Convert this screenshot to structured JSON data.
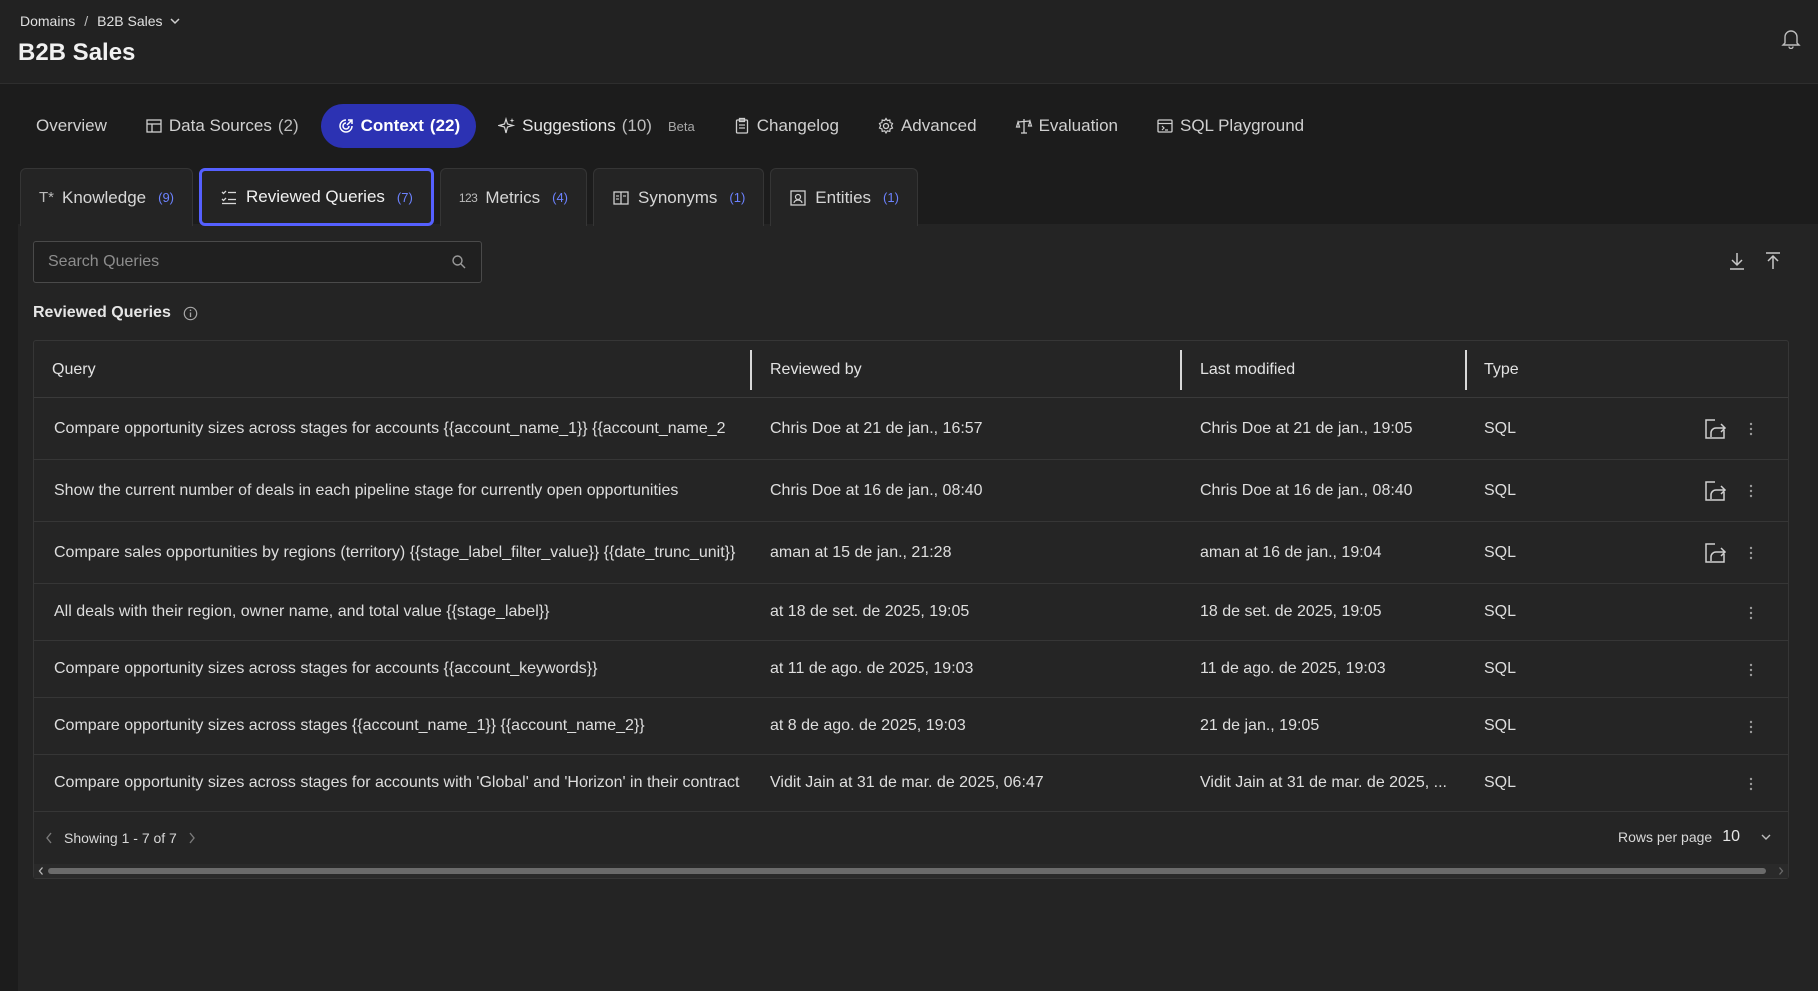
{
  "header": {
    "breadcrumb": [
      "Domains",
      "/",
      "B2B Sales"
    ],
    "title": "B2B Sales"
  },
  "main_tabs": [
    {
      "label": "Overview",
      "count": "",
      "icon": "none"
    },
    {
      "label": "Data Sources",
      "count": "(2)",
      "icon": "table-icon"
    },
    {
      "label": "Context",
      "count": "(22)",
      "icon": "context-icon"
    },
    {
      "label": "Suggestions",
      "count": "(10)",
      "icon": "sparkle-icon",
      "badge": "Beta"
    },
    {
      "label": "Changelog",
      "count": "",
      "icon": "clipboard-icon"
    },
    {
      "label": "Advanced",
      "count": "",
      "icon": "gear-icon"
    },
    {
      "label": "Evaluation",
      "count": "",
      "icon": "scale-icon"
    },
    {
      "label": "SQL Playground",
      "count": "",
      "icon": "playground-icon"
    }
  ],
  "sub_tabs": [
    {
      "label": "Knowledge",
      "count": "(9)",
      "icon": "text-icon",
      "icon_text": "T*"
    },
    {
      "label": "Reviewed Queries",
      "count": "(7)",
      "icon": "list-check-icon"
    },
    {
      "label": "Metrics",
      "count": "(4)",
      "icon": "number-icon",
      "icon_text": "123"
    },
    {
      "label": "Synonyms",
      "count": "(1)",
      "icon": "book-icon"
    },
    {
      "label": "Entities",
      "count": "(1)",
      "icon": "entity-icon"
    }
  ],
  "search": {
    "placeholder": "Search Queries"
  },
  "section_title": "Reviewed Queries",
  "table": {
    "columns": [
      "Query",
      "Reviewed by",
      "Last modified",
      "Type"
    ],
    "rows": [
      {
        "query": "Compare opportunity sizes across stages for accounts {{account_name_1}} {{account_name_2",
        "reviewed_by": "Chris Doe at 21 de jan., 16:57",
        "last_modified": "Chris Doe at 21 de jan., 19:05",
        "type": "SQL",
        "share": true
      },
      {
        "query": "Show the current number of deals in each pipeline stage for currently open opportunities",
        "reviewed_by": "Chris Doe at 16 de jan., 08:40",
        "last_modified": "Chris Doe at 16 de jan., 08:40",
        "type": "SQL",
        "share": true
      },
      {
        "query": "Compare sales opportunities by regions (territory) {{stage_label_filter_value}} {{date_trunc_unit}}",
        "reviewed_by": "aman at 15 de jan., 21:28",
        "last_modified": "aman at 16 de jan., 19:04",
        "type": "SQL",
        "share": true
      },
      {
        "query": "All deals with their region, owner name, and total value {{stage_label}}",
        "reviewed_by": "at 18 de set. de 2025, 19:05",
        "last_modified": "18 de set. de 2025, 19:05",
        "type": "SQL",
        "share": false
      },
      {
        "query": "Compare opportunity sizes across stages for accounts {{account_keywords}}",
        "reviewed_by": "at 11 de ago. de 2025, 19:03",
        "last_modified": "11 de ago. de 2025, 19:03",
        "type": "SQL",
        "share": false
      },
      {
        "query": "Compare opportunity sizes across stages {{account_name_1}} {{account_name_2}}",
        "reviewed_by": "at 8 de ago. de 2025, 19:03",
        "last_modified": "21 de jan., 19:05",
        "type": "SQL",
        "share": false
      },
      {
        "query": "Compare opportunity sizes across stages for accounts with 'Global' and 'Horizon' in their contract",
        "reviewed_by": "Vidit Jain at 31 de mar. de 2025, 06:47",
        "last_modified": "Vidit Jain at 31 de mar. de 2025, ...",
        "type": "SQL",
        "share": false
      }
    ]
  },
  "footer": {
    "showing": "Showing 1 - 7 of 7",
    "rows_per_page_label": "Rows per page",
    "rows_per_page_value": "10"
  },
  "colors": {
    "accent": "#2c32b3",
    "active_outline": "#5560ff",
    "count_blue": "#6c82ff"
  }
}
